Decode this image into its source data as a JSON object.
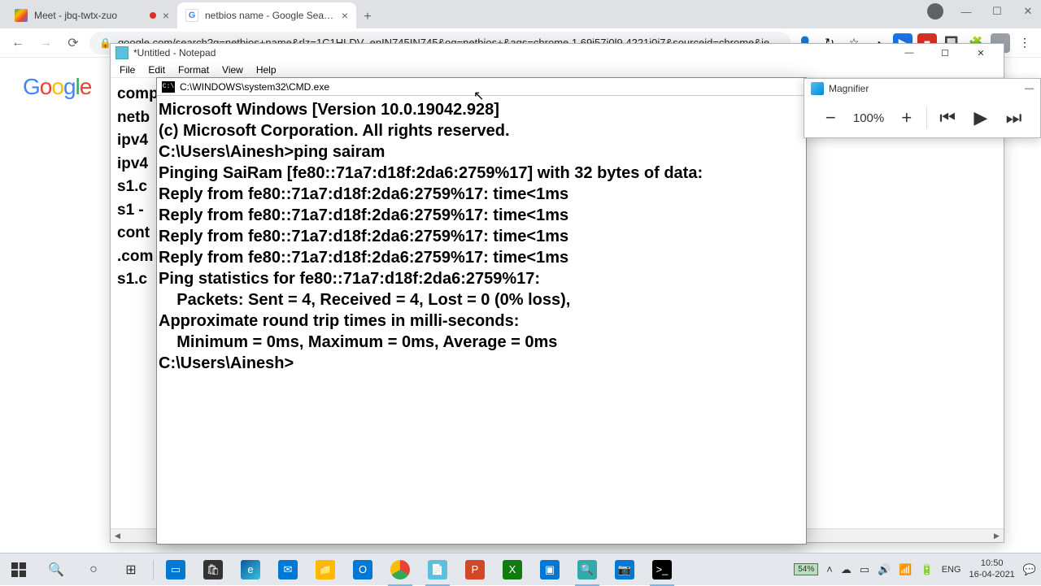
{
  "chrome": {
    "tabs": [
      {
        "favicon": "meet",
        "title": "Meet - jbq-twtx-zuo",
        "recording": true
      },
      {
        "favicon": "google",
        "title": "netbios name - Google Search",
        "recording": false
      }
    ],
    "url": "google.com/search?q=netbios+name&rlz=1C1HLDV_enIN745IN745&oq=netbios+&aqs=chrome.1.69i57j0l9.4221j0j7&sourceid=chrome&ie...",
    "logo": "Google"
  },
  "notepad": {
    "title": "*Untitled - Notepad",
    "menu": [
      "File",
      "Edit",
      "Format",
      "View",
      "Help"
    ],
    "lines": [
      "comp",
      "",
      "netb",
      "ipv4",
      "ipv4",
      "",
      "s1.c",
      "s1 -",
      "cont",
      ".com",
      "",
      "s1.c"
    ]
  },
  "cmd": {
    "title": "C:\\WINDOWS\\system32\\CMD.exe",
    "lines": [
      "Microsoft Windows [Version 10.0.19042.928]",
      "(c) Microsoft Corporation. All rights reserved.",
      "",
      "C:\\Users\\Ainesh>ping sairam",
      "",
      "Pinging SaiRam [fe80::71a7:d18f:2da6:2759%17] with 32 bytes of data:",
      "Reply from fe80::71a7:d18f:2da6:2759%17: time<1ms",
      "Reply from fe80::71a7:d18f:2da6:2759%17: time<1ms",
      "Reply from fe80::71a7:d18f:2da6:2759%17: time<1ms",
      "Reply from fe80::71a7:d18f:2da6:2759%17: time<1ms",
      "",
      "Ping statistics for fe80::71a7:d18f:2da6:2759%17:",
      "    Packets: Sent = 4, Received = 4, Lost = 0 (0% loss),",
      "Approximate round trip times in milli-seconds:",
      "    Minimum = 0ms, Maximum = 0ms, Average = 0ms",
      "",
      "C:\\Users\\Ainesh>"
    ]
  },
  "magnifier": {
    "title": "Magnifier",
    "zoom": "100%"
  },
  "taskbar": {
    "battery": "54%",
    "lang": "ENG",
    "time": "10:50",
    "date": "16-04-2021"
  }
}
